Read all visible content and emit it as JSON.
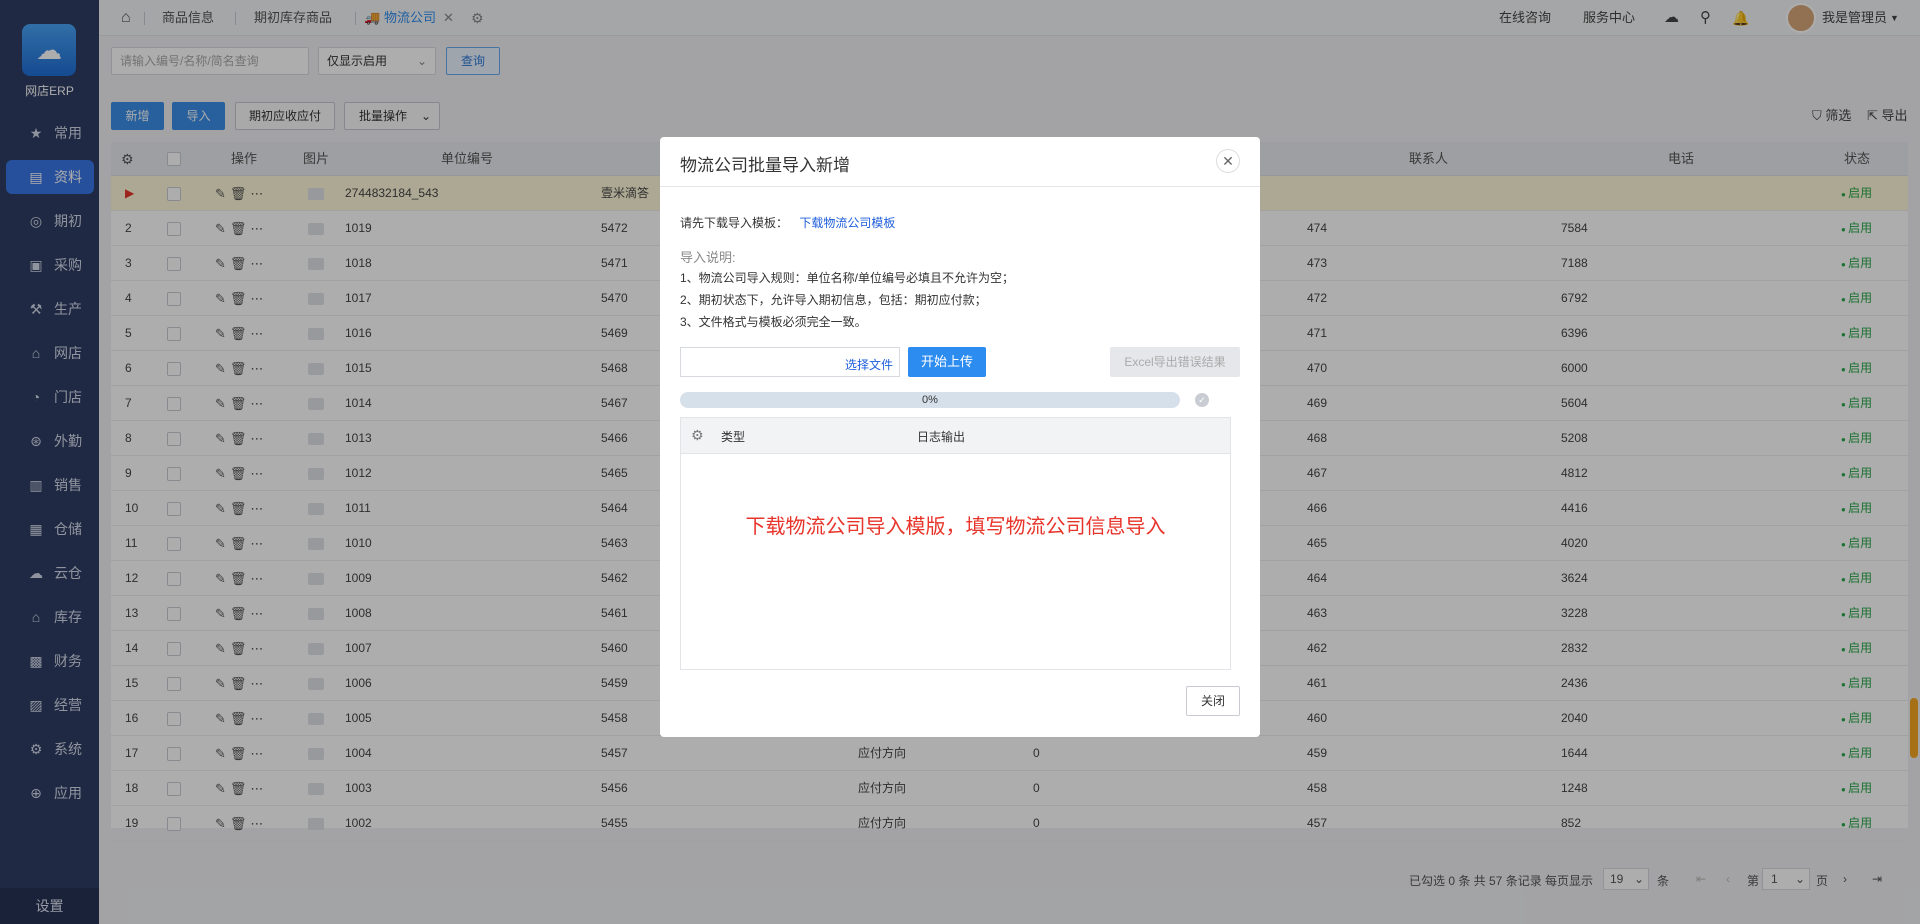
{
  "app": {
    "name": "网店ERP"
  },
  "sidebar": {
    "items": [
      {
        "label": "常用",
        "icon": "star-icon"
      },
      {
        "label": "资料",
        "icon": "document-icon"
      },
      {
        "label": "期初",
        "icon": "circle-icon"
      },
      {
        "label": "采购",
        "icon": "purchase-icon"
      },
      {
        "label": "生产",
        "icon": "production-icon"
      },
      {
        "label": "网店",
        "icon": "shop-icon"
      },
      {
        "label": "门店",
        "icon": "store-icon"
      },
      {
        "label": "外勤",
        "icon": "field-icon"
      },
      {
        "label": "销售",
        "icon": "sales-icon"
      },
      {
        "label": "仓储",
        "icon": "warehouse-icon"
      },
      {
        "label": "云仓",
        "icon": "cloud-warehouse-icon"
      },
      {
        "label": "库存",
        "icon": "inventory-icon"
      },
      {
        "label": "财务",
        "icon": "finance-icon"
      },
      {
        "label": "经营",
        "icon": "business-icon"
      },
      {
        "label": "系统",
        "icon": "gear-icon"
      },
      {
        "label": "应用",
        "icon": "plus-icon"
      }
    ],
    "active": "资料",
    "settings_label": "设置"
  },
  "topbar": {
    "tabs": [
      {
        "label": "商品信息"
      },
      {
        "label": "期初库存商品"
      },
      {
        "label": "物流公司"
      }
    ],
    "links": [
      "在线咨询",
      "服务中心"
    ],
    "user": "我是管理员"
  },
  "toolbar": {
    "search_placeholder": "请输入编号/名称/简名查询",
    "filter_value": "仅显示启用",
    "query_label": "查询",
    "add_label": "新增",
    "import_label": "导入",
    "initial_label": "期初应收应付",
    "batch_label": "批量操作",
    "screen_label": "筛选",
    "export_label": "导出"
  },
  "table": {
    "headers": [
      "操作",
      "图片",
      "单位编号",
      "联系人",
      "电话",
      "状态"
    ],
    "rows": [
      {
        "n": "",
        "code": "2744832184_543",
        "name": "壹米滴答",
        "dir": "",
        "amt": "",
        "contact": "",
        "phone": "",
        "status": "启用"
      },
      {
        "n": "2",
        "code": "1019",
        "name": "5472",
        "dir": "",
        "amt": "",
        "contact": "474",
        "phone": "7584",
        "status": "启用"
      },
      {
        "n": "3",
        "code": "1018",
        "name": "5471",
        "dir": "",
        "amt": "",
        "contact": "473",
        "phone": "7188",
        "status": "启用"
      },
      {
        "n": "4",
        "code": "1017",
        "name": "5470",
        "dir": "",
        "amt": "",
        "contact": "472",
        "phone": "6792",
        "status": "启用"
      },
      {
        "n": "5",
        "code": "1016",
        "name": "5469",
        "dir": "",
        "amt": "",
        "contact": "471",
        "phone": "6396",
        "status": "启用"
      },
      {
        "n": "6",
        "code": "1015",
        "name": "5468",
        "dir": "",
        "amt": "",
        "contact": "470",
        "phone": "6000",
        "status": "启用"
      },
      {
        "n": "7",
        "code": "1014",
        "name": "5467",
        "dir": "",
        "amt": "",
        "contact": "469",
        "phone": "5604",
        "status": "启用"
      },
      {
        "n": "8",
        "code": "1013",
        "name": "5466",
        "dir": "",
        "amt": "",
        "contact": "468",
        "phone": "5208",
        "status": "启用"
      },
      {
        "n": "9",
        "code": "1012",
        "name": "5465",
        "dir": "",
        "amt": "",
        "contact": "467",
        "phone": "4812",
        "status": "启用"
      },
      {
        "n": "10",
        "code": "1011",
        "name": "5464",
        "dir": "",
        "amt": "",
        "contact": "466",
        "phone": "4416",
        "status": "启用"
      },
      {
        "n": "11",
        "code": "1010",
        "name": "5463",
        "dir": "",
        "amt": "",
        "contact": "465",
        "phone": "4020",
        "status": "启用"
      },
      {
        "n": "12",
        "code": "1009",
        "name": "5462",
        "dir": "",
        "amt": "",
        "contact": "464",
        "phone": "3624",
        "status": "启用"
      },
      {
        "n": "13",
        "code": "1008",
        "name": "5461",
        "dir": "",
        "amt": "",
        "contact": "463",
        "phone": "3228",
        "status": "启用"
      },
      {
        "n": "14",
        "code": "1007",
        "name": "5460",
        "dir": "",
        "amt": "",
        "contact": "462",
        "phone": "2832",
        "status": "启用"
      },
      {
        "n": "15",
        "code": "1006",
        "name": "5459",
        "dir": "",
        "amt": "",
        "contact": "461",
        "phone": "2436",
        "status": "启用"
      },
      {
        "n": "16",
        "code": "1005",
        "name": "5458",
        "dir": "",
        "amt": "",
        "contact": "460",
        "phone": "2040",
        "status": "启用"
      },
      {
        "n": "17",
        "code": "1004",
        "name": "5457",
        "dir": "应付方向",
        "amt": "0",
        "contact": "459",
        "phone": "1644",
        "status": "启用"
      },
      {
        "n": "18",
        "code": "1003",
        "name": "5456",
        "dir": "应付方向",
        "amt": "0",
        "contact": "458",
        "phone": "1248",
        "status": "启用"
      },
      {
        "n": "19",
        "code": "1002",
        "name": "5455",
        "dir": "应付方向",
        "amt": "0",
        "contact": "457",
        "phone": "852",
        "status": "启用"
      }
    ]
  },
  "pager": {
    "summary": "已勾选 0 条  共 57 条记录  每页显示",
    "per_page": "19",
    "unit": "条",
    "page_label": "第",
    "page": "1",
    "page_unit": "页"
  },
  "modal": {
    "title": "物流公司批量导入新增",
    "download_prompt": "请先下载导入模板：",
    "download_link": "下载物流公司模板",
    "notes_title": "导入说明:",
    "notes": [
      "1、物流公司导入规则：单位名称/单位编号必填且不允许为空；",
      "2、期初状态下，允许导入期初信息，包括：期初应付款；",
      "3、文件格式与模板必须完全一致。"
    ],
    "choose_file": "选择文件",
    "upload_label": "开始上传",
    "excel_error_label": "Excel导出错误结果",
    "progress_text": "0%",
    "progress_value": 0,
    "log_headers": [
      "类型",
      "日志输出"
    ],
    "annotation": "下载物流公司导入模版，填写物流公司信息导入",
    "close_label": "关闭"
  }
}
